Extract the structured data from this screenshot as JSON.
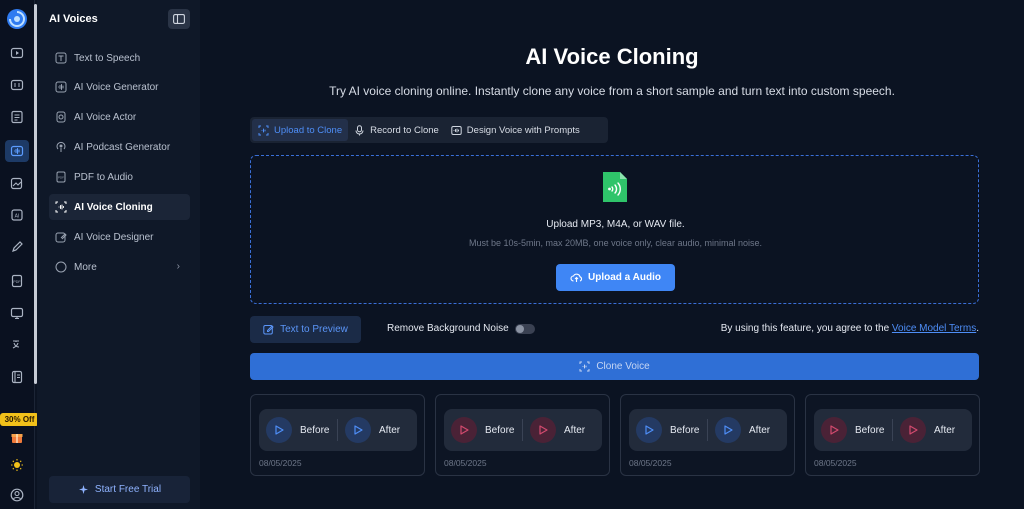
{
  "colors": {
    "accent": "#3f86f5",
    "background": "#0b1322",
    "sidebar": "#0f1828",
    "promo": "#f2c11a",
    "play_blue": "#4e8ef7",
    "play_red": "#d24a6e"
  },
  "rail": {
    "promo_badge": "30% Off",
    "icons": [
      "logo-icon",
      "video-icon",
      "captions-icon",
      "document-icon",
      "ai-voices-icon",
      "image-edit-icon",
      "ai-chip-icon",
      "pen-icon",
      "pdf-icon",
      "presentation-icon",
      "translate-icon",
      "notebook-icon",
      "gift-icon",
      "sun-icon",
      "user-icon"
    ]
  },
  "sidebar": {
    "title": "AI Voices",
    "items": [
      {
        "label": "Text to Speech",
        "icon": "text-icon"
      },
      {
        "label": "AI Voice Generator",
        "icon": "waveform-icon"
      },
      {
        "label": "AI Voice Actor",
        "icon": "actor-icon"
      },
      {
        "label": "AI Podcast Generator",
        "icon": "podcast-icon"
      },
      {
        "label": "PDF to Audio",
        "icon": "pdf-icon"
      },
      {
        "label": "AI Voice Cloning",
        "icon": "clone-icon",
        "active": true
      },
      {
        "label": "AI Voice Designer",
        "icon": "designer-icon"
      },
      {
        "label": "More",
        "icon": "more-icon"
      }
    ],
    "trial_button": "Start Free Trial"
  },
  "main": {
    "title": "AI Voice Cloning",
    "subtitle": "Try AI voice cloning online. Instantly clone any voice from a short sample and turn text into custom speech.",
    "tabs": [
      {
        "label": "Upload to Clone",
        "icon": "upload-scan-icon",
        "active": true
      },
      {
        "label": "Record to Clone",
        "icon": "microphone-icon"
      },
      {
        "label": "Design Voice with Prompts",
        "icon": "prompt-icon"
      }
    ],
    "upload": {
      "title": "Upload MP3, M4A, or WAV file.",
      "hint": "Must be 10s-5min, max 20MB, one voice only, clear audio, minimal noise.",
      "button": "Upload a Audio"
    },
    "text_to_preview": "Text to Preview",
    "noise_label": "Remove Background Noise",
    "noise_enabled": false,
    "terms_prefix": "By using this feature, you agree to the",
    "terms_link": "Voice Model Terms",
    "terms_suffix": ".",
    "clone_button": "Clone Voice",
    "samples": [
      {
        "before": "Before",
        "after": "After",
        "date": "08/05/2025",
        "tone": "blue"
      },
      {
        "before": "Before",
        "after": "After",
        "date": "08/05/2025",
        "tone": "red"
      },
      {
        "before": "Before",
        "after": "After",
        "date": "08/05/2025",
        "tone": "blue"
      },
      {
        "before": "Before",
        "after": "After",
        "date": "08/05/2025",
        "tone": "red"
      }
    ]
  }
}
